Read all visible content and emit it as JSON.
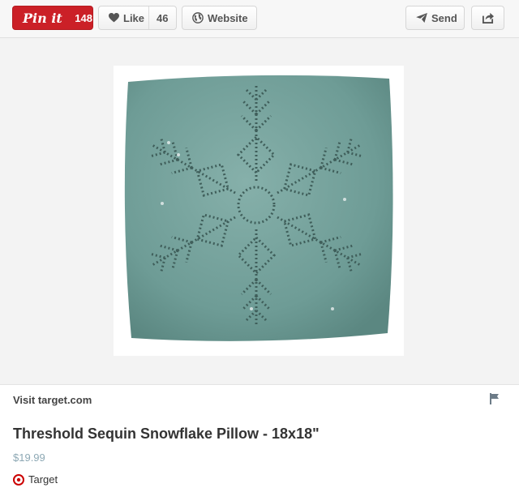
{
  "toolbar": {
    "pin_label": "Pin it",
    "pin_count": "148",
    "like_label": "Like",
    "like_count": "46",
    "website_label": "Website",
    "send_label": "Send",
    "share_icon": "share-icon",
    "colors": {
      "pin_red": "#cb2027",
      "button_text": "#555555"
    }
  },
  "pin_image": {
    "alt": "Threshold Sequin Snowflake Pillow - 18x18\"",
    "colors": {
      "pillow": "#6e9c96",
      "snowflake": "#3f5e5a"
    }
  },
  "details": {
    "visit_link": "Visit target.com",
    "flag_icon": "flag-icon",
    "title": "Threshold Sequin Snowflake Pillow - 18x18\"",
    "price": "$19.99",
    "source_name": "Target",
    "source_icon": "target-logo-icon",
    "colors": {
      "price": "#8da8b4",
      "target_red": "#cc0000"
    }
  }
}
